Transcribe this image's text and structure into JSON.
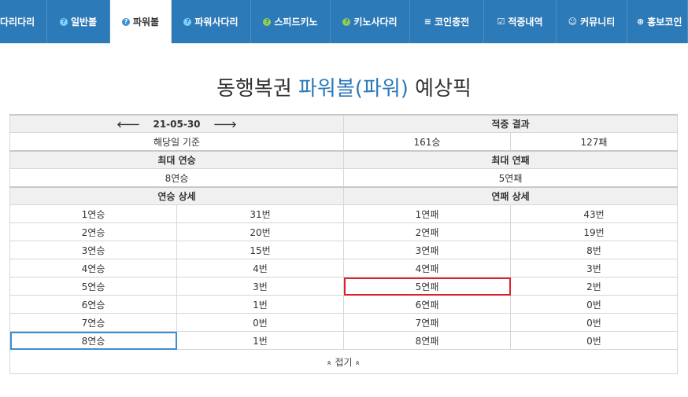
{
  "nav": {
    "items": [
      {
        "label": "다리다리",
        "icon": ""
      },
      {
        "label": "일반볼",
        "icon": "?"
      },
      {
        "label": "파워볼",
        "icon": "?"
      },
      {
        "label": "파워사다리",
        "icon": "?"
      },
      {
        "label": "스피드키노",
        "icon": "?"
      },
      {
        "label": "키노사다리",
        "icon": "?"
      },
      {
        "label": "코인충전",
        "icon": "≡"
      },
      {
        "label": "적중내역",
        "icon": "☑"
      },
      {
        "label": "커뮤니티",
        "icon": "☺"
      },
      {
        "label": "홍보코인",
        "icon": "⊛"
      }
    ]
  },
  "title": {
    "prefix": "동행복권 ",
    "highlight": "파워볼(파워)",
    "suffix": " 예상픽"
  },
  "summary": {
    "date": "21-05-30",
    "prev_arrow": "🡐",
    "next_arrow": "🡒",
    "result_header": "적중 결과",
    "basis": "해당일 기준",
    "wins": "161승",
    "losses": "127패",
    "max_win_header": "최대 연승",
    "max_loss_header": "최대 연패",
    "max_win": "8연승",
    "max_loss": "5연패",
    "win_detail_header": "연승 상세",
    "loss_detail_header": "연패 상세"
  },
  "rows": [
    {
      "w": "1연승",
      "wc": "31번",
      "l": "1연패",
      "lc": "43번"
    },
    {
      "w": "2연승",
      "wc": "20번",
      "l": "2연패",
      "lc": "19번"
    },
    {
      "w": "3연승",
      "wc": "15번",
      "l": "3연패",
      "lc": "8번"
    },
    {
      "w": "4연승",
      "wc": "4번",
      "l": "4연패",
      "lc": "3번"
    },
    {
      "w": "5연승",
      "wc": "3번",
      "l": "5연패",
      "lc": "2번"
    },
    {
      "w": "6연승",
      "wc": "1번",
      "l": "6연패",
      "lc": "0번"
    },
    {
      "w": "7연승",
      "wc": "0번",
      "l": "7연패",
      "lc": "0번"
    },
    {
      "w": "8연승",
      "wc": "1번",
      "l": "8연패",
      "lc": "0번"
    }
  ],
  "fold": {
    "label": "접기",
    "icon": "«"
  },
  "colors": {
    "nav": "#2d7ab8",
    "highlight": "#2d7ab8",
    "red_box": "#d9232e",
    "blue_box": "#3d8fd1"
  }
}
